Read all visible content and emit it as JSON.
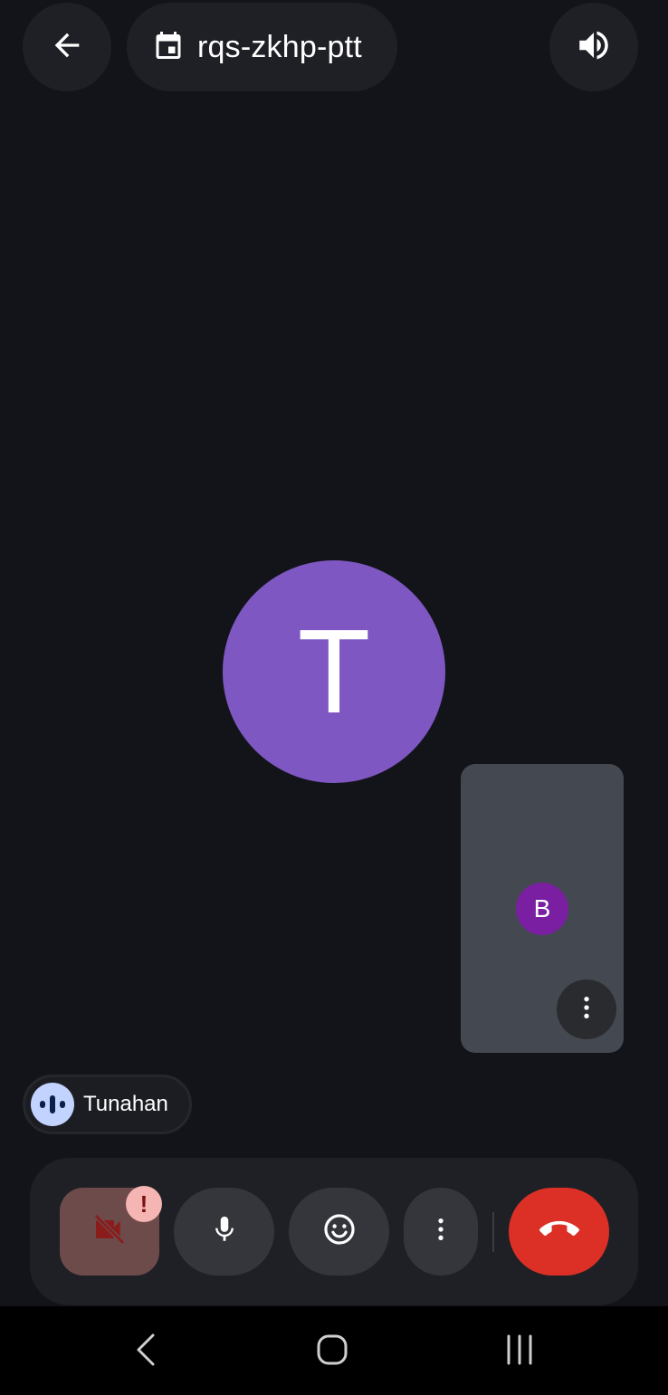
{
  "header": {
    "back_icon": "arrow-back-icon",
    "calendar_icon": "calendar-event-icon",
    "meeting_code": "rqs-zkhp-ptt",
    "speaker_icon": "volume-up-icon"
  },
  "main": {
    "participant_initial": "T",
    "avatar_color": "#7e57c2"
  },
  "self_view": {
    "initial": "B",
    "avatar_color": "#7b1fa2",
    "more_icon": "more-vert-icon"
  },
  "active_speaker": {
    "name": "Tunahan",
    "icon": "audio-wave-icon"
  },
  "controls": {
    "camera_icon": "videocam-off-icon",
    "camera_alert": "!",
    "mic_icon": "mic-icon",
    "reactions_icon": "emoji-icon",
    "more_icon": "more-vert-icon",
    "end_call_icon": "call-end-icon",
    "end_call_color": "#dc3026"
  },
  "system_nav": {
    "back_icon": "nav-back-icon",
    "home_icon": "nav-home-icon",
    "recents_icon": "nav-recents-icon"
  }
}
